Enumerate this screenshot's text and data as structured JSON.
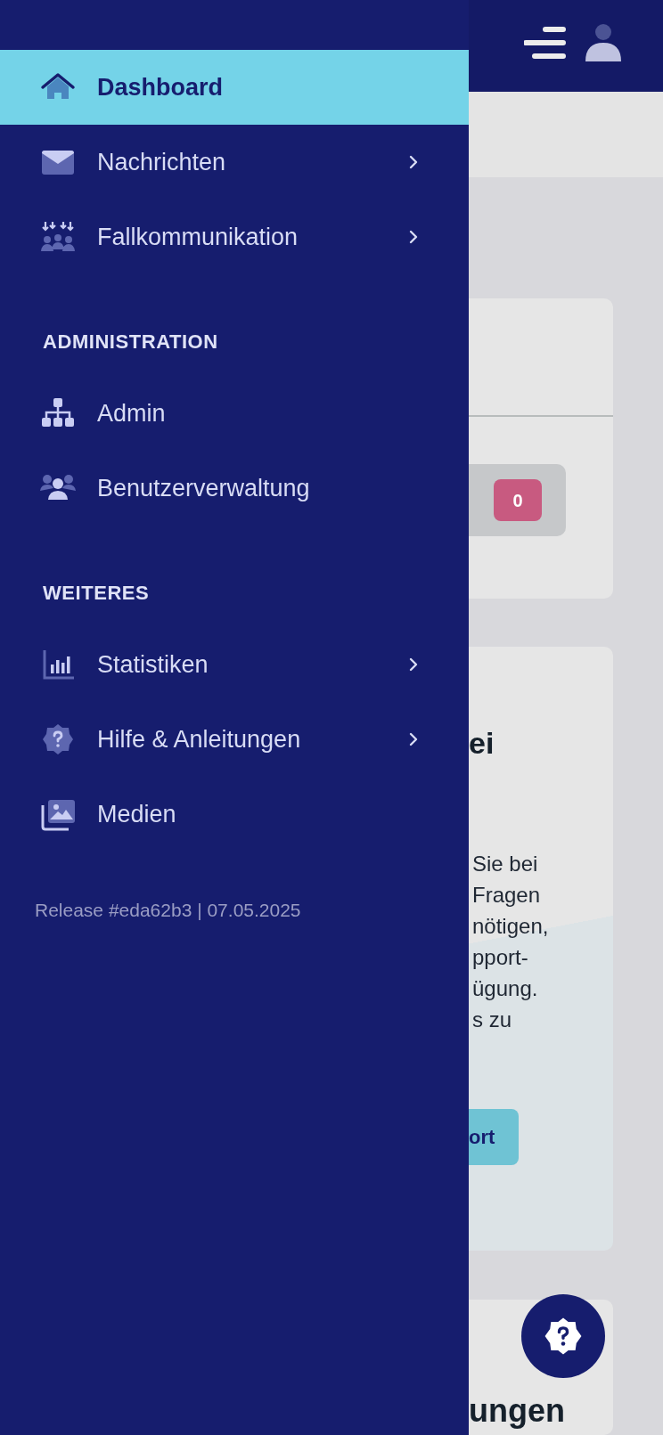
{
  "drawer": {
    "sections": [
      {
        "items": [
          {
            "label": "Dashboard",
            "selected": true,
            "has_submenu": false
          },
          {
            "label": "Nachrichten",
            "selected": false,
            "has_submenu": true
          },
          {
            "label": "Fallkommunikation",
            "selected": false,
            "has_submenu": true
          }
        ]
      },
      {
        "title": "ADMINISTRATION",
        "items": [
          {
            "label": "Admin",
            "selected": false,
            "has_submenu": false
          },
          {
            "label": "Benutzerverwaltung",
            "selected": false,
            "has_submenu": false
          }
        ]
      },
      {
        "title": "WEITERES",
        "items": [
          {
            "label": "Statistiken",
            "selected": false,
            "has_submenu": true
          },
          {
            "label": "Hilfe & Anleitungen",
            "selected": false,
            "has_submenu": true
          },
          {
            "label": "Medien",
            "selected": false,
            "has_submenu": false
          }
        ]
      }
    ],
    "release": "Release #eda62b3 | 07.05.2025"
  },
  "background": {
    "badge_count": "0",
    "support_card": {
      "title_fragment": "ei",
      "text_lines": [
        "Sie bei",
        "Fragen",
        "nötigen,",
        "pport-",
        "ügung.",
        "s zu"
      ],
      "button": "ort"
    },
    "next_card_title_fragment": "ungen"
  }
}
